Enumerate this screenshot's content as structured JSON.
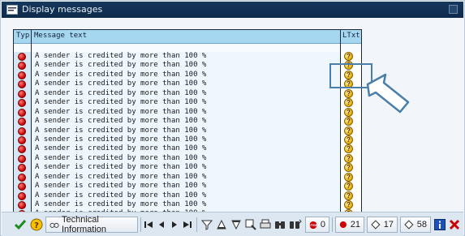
{
  "window": {
    "title": "Display messages"
  },
  "table": {
    "headers": {
      "typ": "Typ",
      "message": "Message text",
      "ltxt": "LTxt"
    },
    "rows": [
      {
        "type": "error",
        "text": "A sender is credited by more than 100 %",
        "ltxt_icon": "help-icon"
      },
      {
        "type": "error",
        "text": "A sender is credited by more than 100 %",
        "ltxt_icon": "help-icon"
      },
      {
        "type": "error",
        "text": "A sender is credited by more than 100 %",
        "ltxt_icon": "help-icon"
      },
      {
        "type": "error",
        "text": "A sender is credited by more than 100 %",
        "ltxt_icon": "help-icon"
      },
      {
        "type": "error",
        "text": "A sender is credited by more than 100 %",
        "ltxt_icon": "help-icon"
      },
      {
        "type": "error",
        "text": "A sender is credited by more than 100 %",
        "ltxt_icon": "help-icon"
      },
      {
        "type": "error",
        "text": "A sender is credited by more than 100 %",
        "ltxt_icon": "help-icon"
      },
      {
        "type": "error",
        "text": "A sender is credited by more than 100 %",
        "ltxt_icon": "help-icon"
      },
      {
        "type": "error",
        "text": "A sender is credited by more than 100 %",
        "ltxt_icon": "help-icon"
      },
      {
        "type": "error",
        "text": "A sender is credited by more than 100 %",
        "ltxt_icon": "help-icon"
      },
      {
        "type": "error",
        "text": "A sender is credited by more than 100 %",
        "ltxt_icon": "help-icon"
      },
      {
        "type": "error",
        "text": "A sender is credited by more than 100 %",
        "ltxt_icon": "help-icon"
      },
      {
        "type": "error",
        "text": "A sender is credited by more than 100 %",
        "ltxt_icon": "help-icon"
      },
      {
        "type": "error",
        "text": "A sender is credited by more than 100 %",
        "ltxt_icon": "help-icon"
      },
      {
        "type": "error",
        "text": "A sender is credited by more than 100 %",
        "ltxt_icon": "help-icon"
      },
      {
        "type": "error",
        "text": "A sender is credited by more than 100 %",
        "ltxt_icon": "help-icon"
      },
      {
        "type": "error",
        "text": "A sender is credited by more than 100 %",
        "ltxt_icon": "help-icon"
      },
      {
        "type": "error",
        "text": "A sender is credited by more than 100 %",
        "ltxt_icon": "help-icon"
      }
    ]
  },
  "toolbar": {
    "technical_info_label": "Technical Information",
    "stop_count": "0",
    "error_count": "21",
    "warning_count": "17",
    "info_count": "58"
  },
  "colors": {
    "title_bar": "#0e2a4a",
    "header_bg": "#a6d7f0",
    "callout": "#4a7faa",
    "error_red": "#c20000",
    "help_yellow": "#e0a800"
  }
}
